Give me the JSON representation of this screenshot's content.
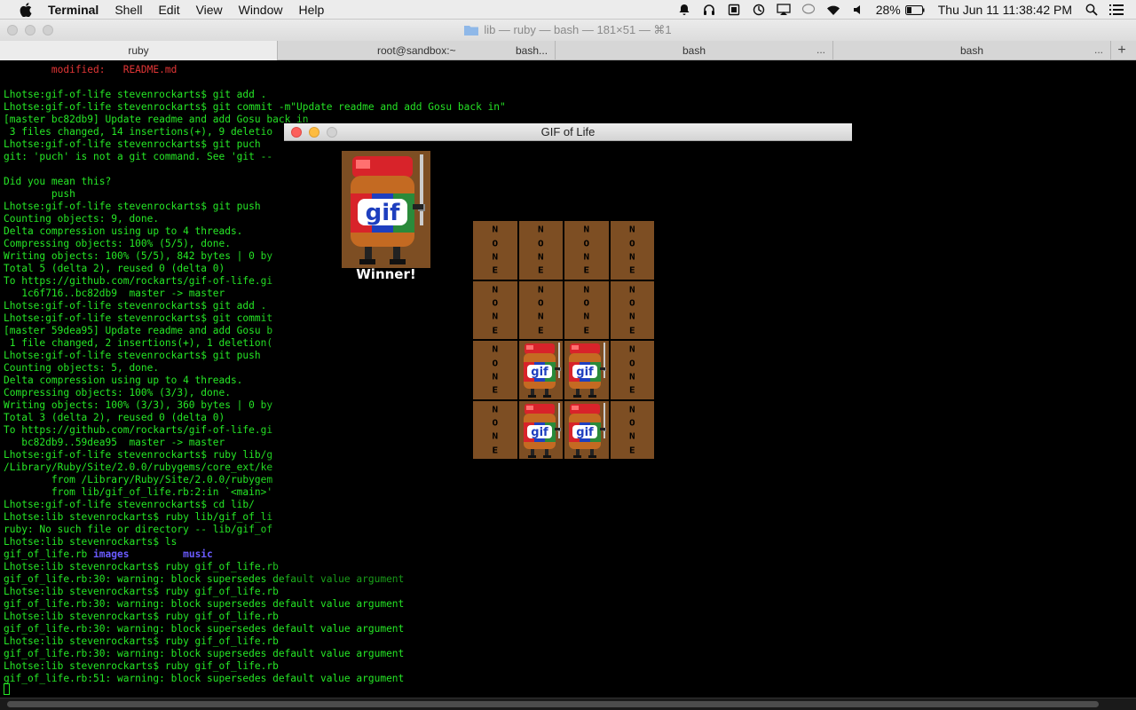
{
  "menubar": {
    "app_name": "Terminal",
    "items": [
      "Shell",
      "Edit",
      "View",
      "Window",
      "Help"
    ],
    "battery": "28%",
    "clock": "Thu Jun 11  11:38:42 PM",
    "icons": [
      "apple-icon",
      "notification-bell-icon",
      "headphones-icon",
      "dropbox-icon",
      "sync-icon",
      "airplay-icon",
      "chat-bubble-icon",
      "wifi-icon",
      "volume-icon",
      "battery-icon",
      "spotlight-search-icon",
      "notification-center-icon"
    ]
  },
  "window": {
    "title": "lib — ruby — bash — 181×51 — ⌘1"
  },
  "tabs": [
    {
      "label": "ruby",
      "more": ""
    },
    {
      "label": "root@sandbox:~",
      "more": ""
    },
    {
      "label": "bash...",
      "more": ""
    },
    {
      "label": "bash",
      "more": "..."
    },
    {
      "label": "bash",
      "more": "..."
    }
  ],
  "terminal": {
    "lines": [
      {
        "text": "\tmodified:   README.md",
        "style": "red"
      },
      {
        "text": "",
        "style": ""
      },
      {
        "text": "Lhotse:gif-of-life stevenrockarts$ git add .",
        "style": ""
      },
      {
        "text": "Lhotse:gif-of-life stevenrockarts$ git commit -m\"Update readme and add Gosu back in\"",
        "style": ""
      },
      {
        "text": "[master bc82db9] Update readme and add Gosu back in",
        "style": ""
      },
      {
        "text": " 3 files changed, 14 insertions(+), 9 deletio",
        "style": ""
      },
      {
        "text": "Lhotse:gif-of-life stevenrockarts$ git puch",
        "style": ""
      },
      {
        "text": "git: 'puch' is not a git command. See 'git --",
        "style": ""
      },
      {
        "text": "",
        "style": ""
      },
      {
        "text": "Did you mean this?",
        "style": ""
      },
      {
        "text": "\tpush",
        "style": ""
      },
      {
        "text": "Lhotse:gif-of-life stevenrockarts$ git push",
        "style": ""
      },
      {
        "text": "Counting objects: 9, done.",
        "style": ""
      },
      {
        "text": "Delta compression using up to 4 threads.",
        "style": ""
      },
      {
        "text": "Compressing objects: 100% (5/5), done.",
        "style": ""
      },
      {
        "text": "Writing objects: 100% (5/5), 842 bytes | 0 by",
        "style": ""
      },
      {
        "text": "Total 5 (delta 2), reused 0 (delta 0)",
        "style": ""
      },
      {
        "text": "To https://github.com/rockarts/gif-of-life.gi",
        "style": ""
      },
      {
        "text": "   1c6f716..bc82db9  master -> master",
        "style": ""
      },
      {
        "text": "Lhotse:gif-of-life stevenrockarts$ git add .",
        "style": ""
      },
      {
        "text": "Lhotse:gif-of-life stevenrockarts$ git commit",
        "style": ""
      },
      {
        "text": "[master 59dea95] Update readme and add Gosu b",
        "style": ""
      },
      {
        "text": " 1 file changed, 2 insertions(+), 1 deletion(",
        "style": ""
      },
      {
        "text": "Lhotse:gif-of-life stevenrockarts$ git push",
        "style": ""
      },
      {
        "text": "Counting objects: 5, done.",
        "style": ""
      },
      {
        "text": "Delta compression using up to 4 threads.",
        "style": ""
      },
      {
        "text": "Compressing objects: 100% (3/3), done.",
        "style": ""
      },
      {
        "text": "Writing objects: 100% (3/3), 360 bytes | 0 by",
        "style": ""
      },
      {
        "text": "Total 3 (delta 2), reused 0 (delta 0)",
        "style": ""
      },
      {
        "text": "To https://github.com/rockarts/gif-of-life.gi",
        "style": ""
      },
      {
        "text": "   bc82db9..59dea95  master -> master",
        "style": ""
      },
      {
        "text": "Lhotse:gif-of-life stevenrockarts$ ruby lib/g",
        "style": ""
      },
      {
        "text": "/Library/Ruby/Site/2.0.0/rubygems/core_ext/ke",
        "style": ""
      },
      {
        "text": "\tfrom /Library/Ruby/Site/2.0.0/rubygem",
        "style": ""
      },
      {
        "text": "\tfrom lib/gif_of_life.rb:2:in `<main>'",
        "style": ""
      },
      {
        "text": "Lhotse:gif-of-life stevenrockarts$ cd lib/",
        "style": ""
      },
      {
        "text": "Lhotse:lib stevenrockarts$ ruby lib/gif_of_li",
        "style": ""
      },
      {
        "text": "ruby: No such file or directory -- lib/gif_of",
        "style": ""
      },
      {
        "text": "Lhotse:lib stevenrockarts$ ls",
        "style": ""
      },
      {
        "text": "gif_of_life.rb ",
        "style": "",
        "extra": [
          {
            "text": "images",
            "style": "blue"
          },
          {
            "text": "         ",
            "style": ""
          },
          {
            "text": "music",
            "style": "blue"
          }
        ]
      },
      {
        "text": "Lhotse:lib stevenrockarts$ ruby gif_of_life.rb",
        "style": ""
      },
      {
        "text": "gif_of_life.rb:30: warning: block supersedes default value argument",
        "style": ""
      },
      {
        "text": "Lhotse:lib stevenrockarts$ ruby gif_of_life.rb",
        "style": ""
      },
      {
        "text": "gif_of_life.rb:30: warning: block supersedes default value argument",
        "style": ""
      },
      {
        "text": "Lhotse:lib stevenrockarts$ ruby gif_of_life.rb",
        "style": ""
      },
      {
        "text": "gif_of_life.rb:30: warning: block supersedes default value argument",
        "style": ""
      },
      {
        "text": "Lhotse:lib stevenrockarts$ ruby gif_of_life.rb",
        "style": ""
      },
      {
        "text": "gif_of_life.rb:30: warning: block supersedes default value argument",
        "style": ""
      },
      {
        "text": "Lhotse:lib stevenrockarts$ ruby gif_of_life.rb",
        "style": ""
      },
      {
        "text": "gif_of_life.rb:51: warning: block supersedes default value argument",
        "style": ""
      }
    ]
  },
  "game": {
    "title": "GIF of Life",
    "winner_label": "Winner!",
    "none_letters": [
      "N",
      "O",
      "N",
      "E"
    ],
    "grid": [
      [
        "none",
        "none",
        "none",
        "none"
      ],
      [
        "none",
        "none",
        "none",
        "none"
      ],
      [
        "none",
        "jar",
        "jar",
        "none"
      ],
      [
        "none",
        "jar",
        "jar",
        "none"
      ]
    ],
    "colors": {
      "cell_bg": "#7d4e23",
      "jar_lid": "#d8232a",
      "jar_body": "#c46a22",
      "label_blue": "#1e3fbf",
      "label_green": "#2a8a3a"
    }
  }
}
